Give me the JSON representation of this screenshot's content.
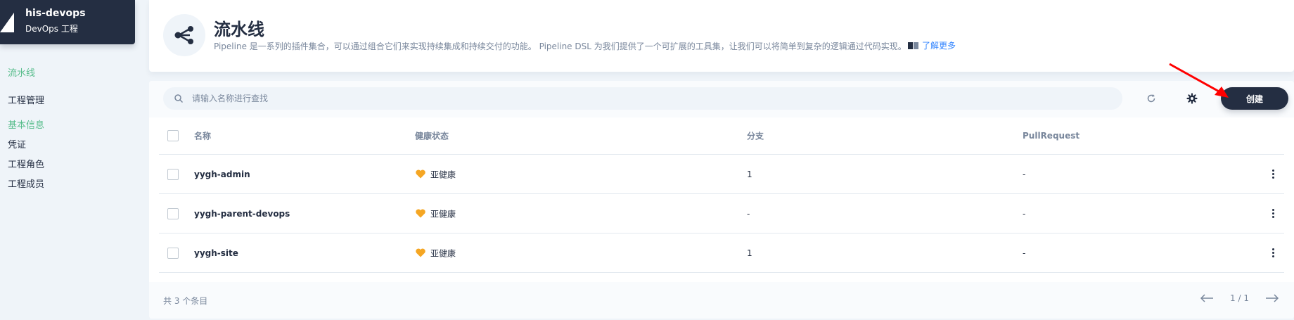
{
  "project": {
    "name": "his-devops",
    "type": "DevOps 工程"
  },
  "sidebar": {
    "pipeline": "流水线",
    "project_management": "工程管理",
    "basic_info_group": "基本信息",
    "items": [
      {
        "label": "凭证"
      },
      {
        "label": "工程角色"
      },
      {
        "label": "工程成员"
      }
    ]
  },
  "header": {
    "title": "流水线",
    "description": "Pipeline 是一系列的插件集合，可以通过组合它们来实现持续集成和持续交付的功能。 Pipeline DSL 为我们提供了一个可扩展的工具集，让我们可以将简单到复杂的逻辑通过代码实现。",
    "learn_more": "了解更多",
    "icon": "pipeline-icon"
  },
  "toolbar": {
    "search_placeholder": "请输入名称进行查找",
    "refresh_icon": "refresh-icon",
    "settings_icon": "gear-icon",
    "create_label": "创建"
  },
  "table": {
    "columns": [
      "名称",
      "健康状态",
      "分支",
      "PullRequest"
    ],
    "rows": [
      {
        "name": "yygh-admin",
        "health": "亚健康",
        "branch": "1",
        "pull_request": "-"
      },
      {
        "name": "yygh-parent-devops",
        "health": "亚健康",
        "branch": "-",
        "pull_request": "-"
      },
      {
        "name": "yygh-site",
        "health": "亚健康",
        "branch": "1",
        "pull_request": "-"
      }
    ]
  },
  "footer": {
    "total": "共 3 个条目",
    "page": "1 / 1"
  },
  "colors": {
    "accent_green": "#55bc8a",
    "dark": "#242e42",
    "health_orange": "#f5a623",
    "annotation_red": "#ff0000"
  }
}
